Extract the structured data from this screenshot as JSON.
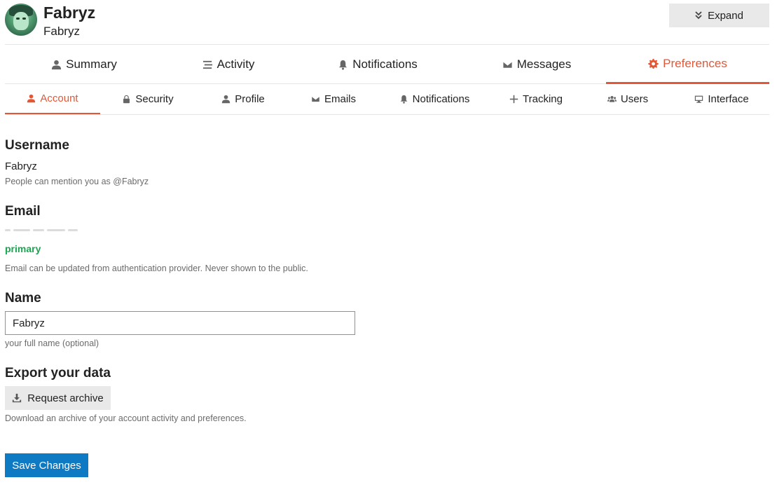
{
  "header": {
    "display_name": "Fabryz",
    "handle": "Fabryz",
    "expand_label": "Expand",
    "avatar_icon": "user-avatar"
  },
  "main_nav": {
    "tabs": [
      {
        "label": "Summary",
        "icon": "user-icon"
      },
      {
        "label": "Activity",
        "icon": "stream-icon"
      },
      {
        "label": "Notifications",
        "icon": "bell-icon"
      },
      {
        "label": "Messages",
        "icon": "envelope-icon"
      },
      {
        "label": "Preferences",
        "icon": "cog-icon",
        "active": true
      }
    ]
  },
  "sub_nav": {
    "tabs": [
      {
        "label": "Account",
        "icon": "user-icon",
        "active": true
      },
      {
        "label": "Security",
        "icon": "lock-icon"
      },
      {
        "label": "Profile",
        "icon": "user-icon"
      },
      {
        "label": "Emails",
        "icon": "envelope-icon"
      },
      {
        "label": "Notifications",
        "icon": "bell-icon"
      },
      {
        "label": "Tracking",
        "icon": "plus-icon"
      },
      {
        "label": "Users",
        "icon": "users-icon"
      },
      {
        "label": "Interface",
        "icon": "desktop-icon"
      }
    ]
  },
  "account": {
    "username": {
      "title": "Username",
      "value": "Fabryz",
      "hint": "People can mention you as @Fabryz"
    },
    "email": {
      "title": "Email",
      "primary_tag": "primary",
      "hint": "Email can be updated from authentication provider. Never shown to the public."
    },
    "name": {
      "title": "Name",
      "value": "Fabryz",
      "hint": "your full name (optional)"
    },
    "export": {
      "title": "Export your data",
      "button_label": "Request archive",
      "hint": "Download an archive of your account activity and preferences."
    },
    "save_label": "Save Changes"
  },
  "colors": {
    "accent": "#e45735",
    "primary_green": "#1ca551",
    "save_blue": "#0e7ac4"
  }
}
